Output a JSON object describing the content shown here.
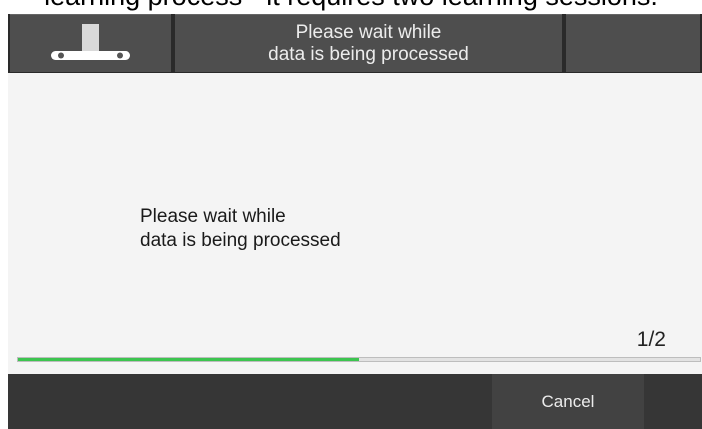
{
  "caption": {
    "text": "learning process - it requires two learning sessions."
  },
  "header": {
    "icon": "range-hood-icon",
    "title_line1": "Please wait while",
    "title_line2": "data is being processed"
  },
  "main": {
    "message_line1": "Please wait while",
    "message_line2": "data is being processed",
    "step": "1/2",
    "progress": 0.5
  },
  "footer": {
    "cancel_label": "Cancel"
  },
  "colors": {
    "header_bg": "#4e4e4e",
    "content_bg": "#f4f4f4",
    "footer_bg": "#363636",
    "progress": "#3cc44f"
  }
}
